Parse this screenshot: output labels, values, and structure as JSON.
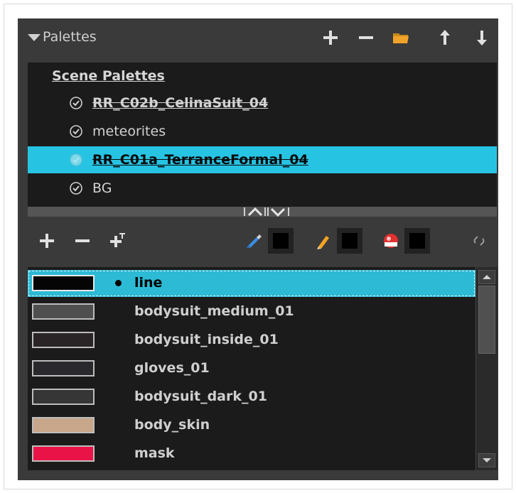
{
  "header": {
    "title": "Palettes"
  },
  "palette_list": {
    "section_title": "Scene Palettes",
    "items": [
      {
        "label": "RR_C02b_CelinaSuit_04",
        "selected": false,
        "style": "strikethrough"
      },
      {
        "label": "meteorites",
        "selected": false,
        "style": "normal"
      },
      {
        "label": "RR_C01a_TerranceFormal_04",
        "selected": true,
        "style": "strikethrough"
      },
      {
        "label": "BG",
        "selected": false,
        "style": "normal"
      }
    ]
  },
  "colors": {
    "items": [
      {
        "label": "line",
        "swatch": "#050505",
        "selected": true,
        "current": true
      },
      {
        "label": "bodysuit_medium_01",
        "swatch": "#4f4f4f",
        "selected": false
      },
      {
        "label": "bodysuit_inside_01",
        "swatch": "#2b2426",
        "selected": false
      },
      {
        "label": "gloves_01",
        "swatch": "#28282d",
        "selected": false
      },
      {
        "label": "bodysuit_dark_01",
        "swatch": "#363636",
        "selected": false
      },
      {
        "label": "body_skin",
        "swatch": "#c8a68a",
        "selected": false
      },
      {
        "label": "mask",
        "swatch": "#ea1347",
        "selected": false
      }
    ]
  },
  "theme": {
    "panel_bg": "#3a3a3a",
    "list_bg": "#1b1b1b",
    "selection": "#27c3e3"
  },
  "icons": [
    "collapse-triangle-icon",
    "plus-icon",
    "minus-icon",
    "folder-icon",
    "arrow-up-icon",
    "arrow-down-icon",
    "checkmark-icon",
    "chevron-up-icon",
    "chevron-down-icon",
    "add-gradient-icon",
    "brush-color-icon",
    "pencil-color-icon",
    "paint-color-icon",
    "link-icon"
  ]
}
